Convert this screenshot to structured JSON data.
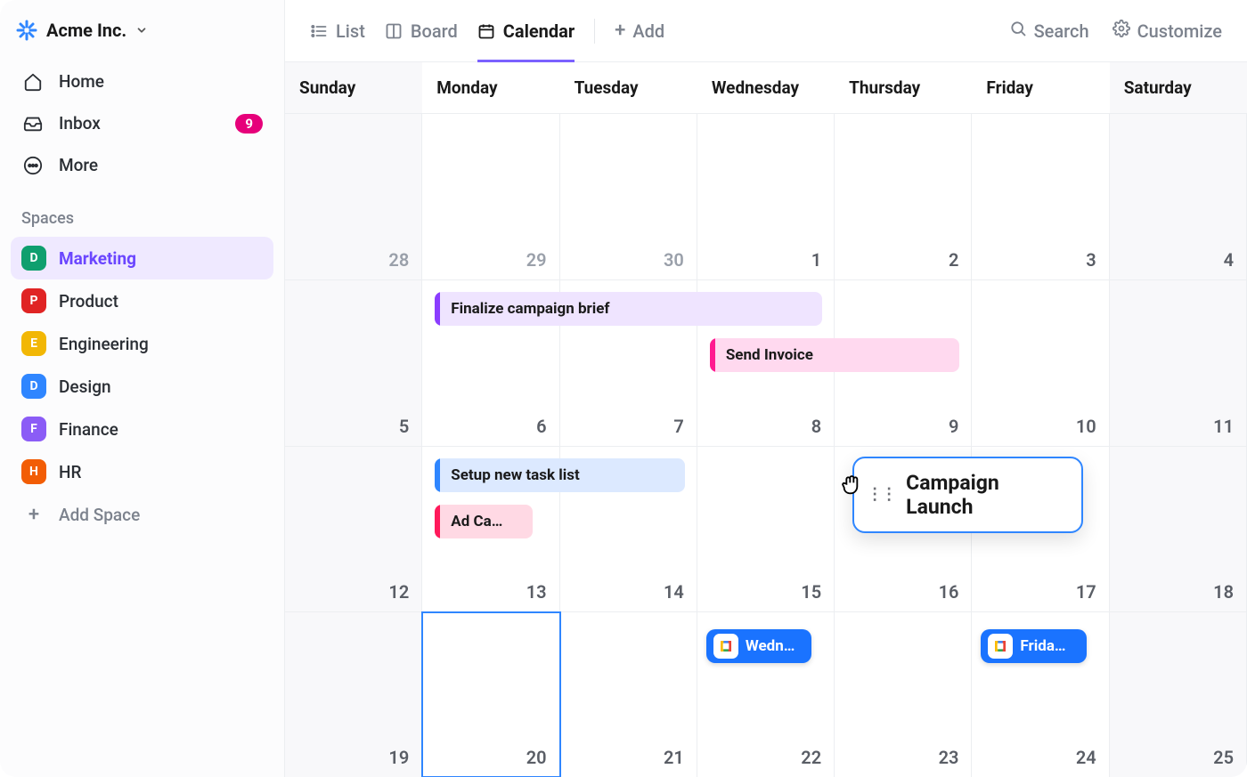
{
  "workspace": {
    "name": "Acme Inc."
  },
  "nav": {
    "home": "Home",
    "inbox": "Inbox",
    "inbox_badge": "9",
    "more": "More"
  },
  "spaces": {
    "section_label": "Spaces",
    "add_label": "Add Space",
    "items": [
      {
        "letter": "D",
        "color": "#0f9f6e",
        "label": "Marketing",
        "active": true
      },
      {
        "letter": "P",
        "color": "#e02424",
        "label": "Product",
        "active": false
      },
      {
        "letter": "E",
        "color": "#f2b705",
        "label": "Engineering",
        "active": false
      },
      {
        "letter": "D",
        "color": "#2f86ff",
        "label": "Design",
        "active": false
      },
      {
        "letter": "F",
        "color": "#8b5cf6",
        "label": "Finance",
        "active": false
      },
      {
        "letter": "H",
        "color": "#f25d05",
        "label": "HR",
        "active": false
      }
    ]
  },
  "toolbar": {
    "views": {
      "list": "List",
      "board": "Board",
      "calendar": "Calendar"
    },
    "add": "Add",
    "search": "Search",
    "customize": "Customize"
  },
  "calendar": {
    "day_names": [
      "Sunday",
      "Monday",
      "Tuesday",
      "Wednesday",
      "Thursday",
      "Friday",
      "Saturday"
    ],
    "rows": [
      [
        {
          "n": "28",
          "dim": true
        },
        {
          "n": "29",
          "dim": true
        },
        {
          "n": "30",
          "dim": true
        },
        {
          "n": "1"
        },
        {
          "n": "2"
        },
        {
          "n": "3"
        },
        {
          "n": "4"
        }
      ],
      [
        {
          "n": "5"
        },
        {
          "n": "6"
        },
        {
          "n": "7"
        },
        {
          "n": "8"
        },
        {
          "n": "9"
        },
        {
          "n": "10"
        },
        {
          "n": "11"
        }
      ],
      [
        {
          "n": "12"
        },
        {
          "n": "13"
        },
        {
          "n": "14"
        },
        {
          "n": "15"
        },
        {
          "n": "16"
        },
        {
          "n": "17"
        },
        {
          "n": "18"
        }
      ],
      [
        {
          "n": "19"
        },
        {
          "n": "20",
          "today": true
        },
        {
          "n": "21"
        },
        {
          "n": "22"
        },
        {
          "n": "23"
        },
        {
          "n": "24"
        },
        {
          "n": "25"
        }
      ]
    ],
    "events": {
      "finalize": {
        "label": "Finalize campaign brief"
      },
      "invoice": {
        "label": "Send Invoice"
      },
      "setup": {
        "label": "Setup new task list"
      },
      "adca": {
        "label": "Ad Ca…"
      },
      "wed": {
        "label": "Wedn…"
      },
      "fri": {
        "label": "Frida…"
      },
      "launch": {
        "label": "Campaign Launch"
      }
    }
  }
}
